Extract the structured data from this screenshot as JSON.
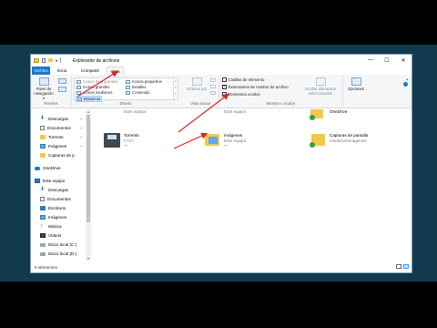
{
  "window": {
    "title": "Explorador de archivos"
  },
  "window_controls": {
    "minimize": "—",
    "maximize": "☐",
    "close": "✕"
  },
  "tabs": [
    {
      "label": "Archivo"
    },
    {
      "label": "Inicio"
    },
    {
      "label": "Compartir"
    },
    {
      "label": "Vista"
    }
  ],
  "ribbon": {
    "panels": {
      "nav_pane": "Panel de navegación",
      "nav_arrow": "▾",
      "group": "Paneles"
    },
    "layout": {
      "items": [
        "Iconos muy grandes",
        "Iconos grandes",
        "Iconos medianos",
        "Iconos pequeños",
        "Lista",
        "Detalles",
        "Mosaicos",
        "Contenido"
      ],
      "group": "Diseño"
    },
    "current_view": {
      "sort": "Ordenar por",
      "group": "Vista actual"
    },
    "show_hide": {
      "checkboxes": [
        {
          "label": "Casillas de elemento",
          "checked": false
        },
        {
          "label": "Extensiones de nombre de archivo",
          "checked": true
        },
        {
          "label": "Elementos ocultos",
          "checked": false
        }
      ],
      "hide_selected": "Ocultar elementos seleccionados",
      "group": "Mostrar u ocultar"
    },
    "options": {
      "label": "Opciones"
    }
  },
  "sidebar": {
    "quick": [
      {
        "label": "Descargas",
        "pinned": true,
        "icon": "download-icon"
      },
      {
        "label": "Documentos",
        "pinned": true,
        "icon": "document-icon"
      },
      {
        "label": "Torrents",
        "pinned": true,
        "icon": "folder-icon"
      },
      {
        "label": "Imágenes",
        "pinned": true,
        "icon": "image-folder-icon"
      },
      {
        "label": "Capturas de p",
        "pinned": true,
        "icon": "folder-icon"
      }
    ],
    "onedrive": "OneDrive",
    "this_pc": "Este equipo",
    "pc_items": [
      {
        "label": "Descargas",
        "icon": "download-icon"
      },
      {
        "label": "Documentos",
        "icon": "document-icon"
      },
      {
        "label": "Escritorio",
        "icon": "desktop-icon"
      },
      {
        "label": "Imágenes",
        "icon": "image-folder-icon"
      },
      {
        "label": "Música",
        "icon": "music-icon"
      },
      {
        "label": "Vídeos",
        "icon": "video-icon"
      },
      {
        "label": "Disco local (C:)",
        "icon": "drive-icon"
      },
      {
        "label": "Disco local (D:)",
        "icon": "drive-icon"
      }
    ],
    "pin_glyph": "⊸"
  },
  "content": {
    "items": [
      {
        "name": "Descargas",
        "sub": "Este equipo",
        "icon": "download-folder-icon"
      },
      {
        "name": "Documentos",
        "sub": "Este equipo",
        "icon": "documents-folder-icon"
      },
      {
        "name": "OneDrive",
        "sub": "",
        "icon": "onedrive-folder-icon"
      },
      {
        "name": "Torrents",
        "sub": "F:\\V:\\",
        "icon": "drive-folder-icon"
      },
      {
        "name": "Imágenes",
        "sub": "Este equipo",
        "icon": "pictures-folder-icon"
      },
      {
        "name": "Capturas de pantalla",
        "sub": "OneDrive\\Imágenes",
        "icon": "screenshots-folder-icon"
      }
    ]
  },
  "status": {
    "count": "6 elementos"
  },
  "colors": {
    "accent": "#1979ca",
    "arrow": "#e02020",
    "frame": "#123a4e"
  }
}
